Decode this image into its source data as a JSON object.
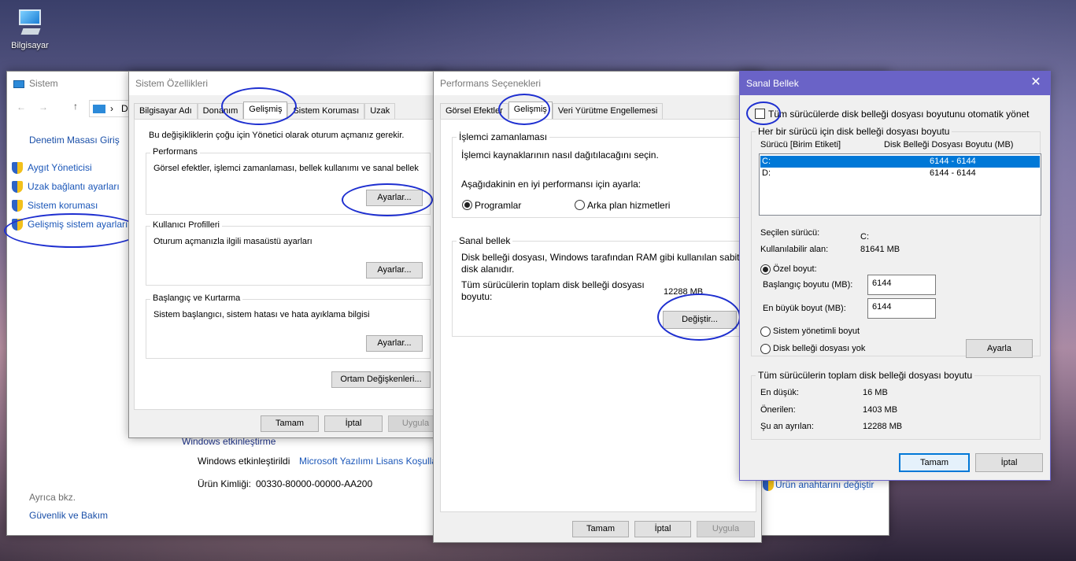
{
  "desktop": {
    "icon_label": "Bilgisayar"
  },
  "system_window": {
    "title": "Sistem",
    "nav_partial": "D",
    "links": {
      "control_panel_home": "Denetim Masası Giriş",
      "device_manager": "Aygıt Yöneticisi",
      "remote_settings": "Uzak bağlantı ayarları",
      "system_protection": "Sistem koruması",
      "advanced_settings": "Gelişmiş sistem ayarları"
    },
    "see_also": "Ayrıca bkz.",
    "security_maintenance": "Güvenlik ve Bakım",
    "activation_heading": "Windows etkinleştirme",
    "activated_text": "Windows etkinleştirildi",
    "license_link": "Microsoft Yazılımı Lisans Koşulla",
    "product_id_label": "Ürün Kimliği:",
    "product_id_value": "00330-80000-00000-AA200",
    "change_key_link": "Ürün anahtarını değiştir"
  },
  "sys_props": {
    "title": "Sistem Özellikleri",
    "tabs": [
      "Bilgisayar Adı",
      "Donanım",
      "Gelişmiş",
      "Sistem Koruması",
      "Uzak"
    ],
    "admin_note": "Bu değişikliklerin çoğu için Yönetici olarak oturum açmanız gerekir.",
    "perf_label": "Performans",
    "perf_desc": "Görsel efektler, işlemci zamanlaması, bellek kullanımı ve sanal bellek",
    "profiles_label": "Kullanıcı Profilleri",
    "profiles_desc": "Oturum açmanızla ilgili masaüstü ayarları",
    "startup_label": "Başlangıç ve Kurtarma",
    "startup_desc": "Sistem başlangıcı, sistem hatası ve hata ayıklama bilgisi",
    "settings_btn": "Ayarlar...",
    "env_btn": "Ortam Değişkenleri...",
    "ok": "Tamam",
    "cancel": "İptal",
    "apply": "Uygula"
  },
  "perf_options": {
    "title": "Performans Seçenekleri",
    "tabs": [
      "Görsel Efektler",
      "Gelişmiş",
      "Veri Yürütme Engellemesi"
    ],
    "sched_label": "İşlemci zamanlaması",
    "sched_desc": "İşlemci kaynaklarının nasıl dağıtılacağını seçin.",
    "adjust_for": "Aşağıdakinin en iyi performansı için ayarla:",
    "programs": "Programlar",
    "background": "Arka plan hizmetleri",
    "vm_label": "Sanal bellek",
    "vm_desc": "Disk belleği dosyası, Windows tarafından RAM gibi kullanılan sabit disk alanıdır.",
    "total_label": "Tüm sürücülerin toplam disk belleği dosyası boyutu:",
    "total_value": "12288 MB",
    "change_btn": "Değiştir...",
    "ok": "Tamam",
    "cancel": "İptal",
    "apply": "Uygula"
  },
  "virtual_memory": {
    "title": "Sanal Bellek",
    "auto_manage": "Tüm sürücülerde disk belleği dosyası boyutunu otomatik yönet",
    "per_drive_label": "Her bir sürücü için disk belleği dosyası boyutu",
    "col_drive": "Sürücü  [Birim Etiketi]",
    "col_size": "Disk Belleği Dosyası Boyutu (MB)",
    "drives": [
      {
        "drive": "C:",
        "size": "6144 - 6144"
      },
      {
        "drive": "D:",
        "size": "6144 - 6144"
      }
    ],
    "selected_drive_label": "Seçilen sürücü:",
    "selected_drive_value": "C:",
    "available_label": "Kullanılabilir alan:",
    "available_value": "81641 MB",
    "custom_size": "Özel boyut:",
    "initial_label": "Başlangıç boyutu (MB):",
    "initial_value": "6144",
    "max_label": "En büyük boyut (MB):",
    "max_value": "6144",
    "system_managed": "Sistem yönetimli boyut",
    "no_paging": "Disk belleği dosyası yok",
    "set_btn": "Ayarla",
    "totals_label": "Tüm sürücülerin toplam disk belleği dosyası boyutu",
    "min_label": "En düşük:",
    "min_value": "16 MB",
    "recommended_label": "Önerilen:",
    "recommended_value": "1403 MB",
    "allocated_label": "Şu an ayrılan:",
    "allocated_value": "12288 MB",
    "ok": "Tamam",
    "cancel": "İptal"
  }
}
